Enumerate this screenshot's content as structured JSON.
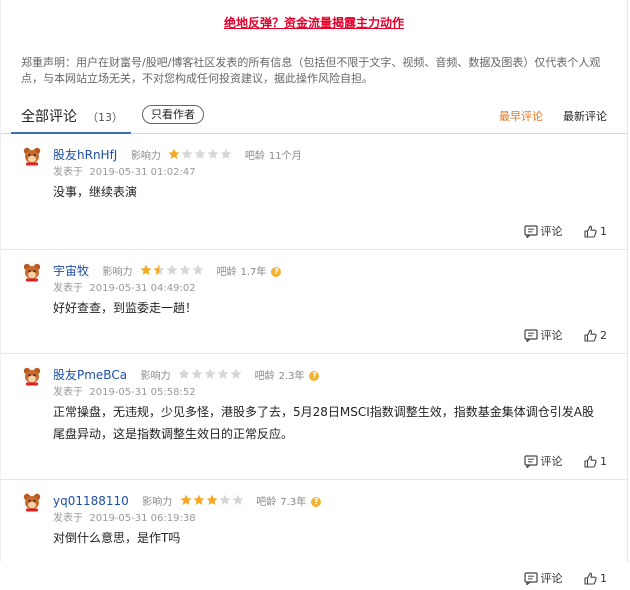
{
  "headline": "绝地反弹？资金流量揭露主力动作",
  "disclaimer": "郑重声明：用户在财富号/股吧/博客社区发表的所有信息（包括但不限于文字、视频、音频、数据及图表）仅代表个人观点，与本网站立场无关，不对您构成任何投资建议，据此操作风险自担。",
  "tabs": {
    "all_label": "全部评论",
    "count": "（13）",
    "only_author": "只看作者",
    "sort_earliest": "最早评论",
    "sort_latest": "最新评论"
  },
  "labels": {
    "influence": "影响力",
    "age": "吧龄",
    "posted_prefix": "发表于",
    "reply": "评论"
  },
  "colors": {
    "star_filled": "#f5a623",
    "star_empty": "#d6d6d6",
    "username": "#1f4fa5",
    "accent_orange": "#e8731a",
    "headline_red": "#e4002b"
  },
  "comments": [
    {
      "username": "股友hRnHfJ",
      "influence_stars": 1,
      "age": "11个月",
      "posted": "2019-05-31 01:02:47",
      "text": "没事，继续表演",
      "likes": "1"
    },
    {
      "username": "宇宙牧",
      "influence_stars": 1.5,
      "age": "1.7年",
      "posted": "2019-05-31 04:49:02",
      "text": "好好查查，到监委走一趟！",
      "likes": "2"
    },
    {
      "username": "股友PmeBCa",
      "influence_stars": 0,
      "age": "2.3年",
      "posted": "2019-05-31 05:58:52",
      "text": "正常操盘，无违规，少见多怪，港股多了去，5月28日MSCI指数调整生效，指数基金集体调仓引发A股尾盘异动，这是指数调整生效日的正常反应。",
      "likes": "1"
    },
    {
      "username": "yq01188110",
      "influence_stars": 3,
      "age": "7.3年",
      "posted": "2019-05-31 06:19:38",
      "text": "对倒什么意思，是作T吗",
      "likes": "1"
    }
  ]
}
